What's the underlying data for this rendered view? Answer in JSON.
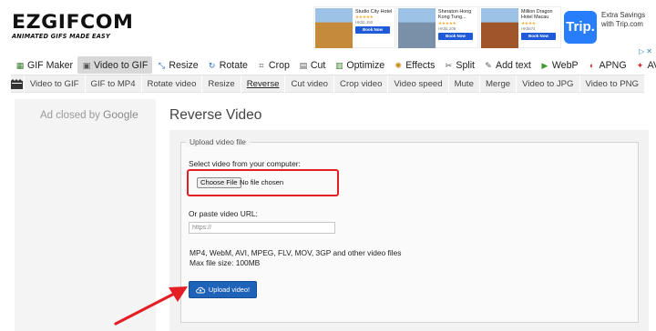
{
  "logo": {
    "main": "EZGIFCOM",
    "tagline": "ANIMATED GIFS MADE EASY"
  },
  "ad_banner": {
    "hotels": [
      {
        "name": "Studio City Hotel",
        "stars": "★★★★★",
        "price": "HK$1,150",
        "button": "Book Now",
        "image_color": "#c58a3a"
      },
      {
        "name": "Sheraton Hong Kong Tung...",
        "stars": "★★★★★",
        "price": "HK$1,208",
        "button": "Book Now",
        "image_color": "#7a8fa8"
      },
      {
        "name": "Million Dragon Hotel Macau",
        "stars": "★★★★",
        "price": "HK$474",
        "button": "Book Now",
        "image_color": "#a0552b"
      }
    ],
    "brand": "Trip.",
    "tagline": "Extra Savings with Trip.com",
    "close": "▷✕"
  },
  "toolbar": {
    "items": [
      {
        "label": "GIF Maker",
        "icon": "gif-maker-icon",
        "glyph": "▦",
        "color": "#3a7d2c",
        "active": false
      },
      {
        "label": "Video to GIF",
        "icon": "video-to-gif-icon",
        "glyph": "▣",
        "color": "#555",
        "active": true
      },
      {
        "label": "Resize",
        "icon": "resize-icon",
        "glyph": "⤡",
        "color": "#2a6fc9",
        "active": false
      },
      {
        "label": "Rotate",
        "icon": "rotate-icon",
        "glyph": "↻",
        "color": "#2a6fc9",
        "active": false
      },
      {
        "label": "Crop",
        "icon": "crop-icon",
        "glyph": "⌗",
        "color": "#555",
        "active": false
      },
      {
        "label": "Cut",
        "icon": "cut-icon",
        "glyph": "▤",
        "color": "#555",
        "active": false
      },
      {
        "label": "Optimize",
        "icon": "optimize-icon",
        "glyph": "▥",
        "color": "#3a7d2c",
        "active": false
      },
      {
        "label": "Effects",
        "icon": "effects-icon",
        "glyph": "✺",
        "color": "#c98a1a",
        "active": false
      },
      {
        "label": "Split",
        "icon": "split-icon",
        "glyph": "✂",
        "color": "#555",
        "active": false
      },
      {
        "label": "Add text",
        "icon": "add-text-icon",
        "glyph": "✎",
        "color": "#555",
        "active": false
      },
      {
        "label": "WebP",
        "icon": "webp-icon",
        "glyph": "▶",
        "color": "#3a9d2c",
        "active": false
      },
      {
        "label": "APNG",
        "icon": "apng-icon",
        "glyph": "◐",
        "color": "#d42a2a",
        "active": false
      },
      {
        "label": "AVIF",
        "icon": "avif-icon",
        "glyph": "✦",
        "color": "#d42a2a",
        "active": false
      }
    ]
  },
  "subbar": {
    "items": [
      {
        "label": "Video to GIF",
        "active": false
      },
      {
        "label": "GIF to MP4",
        "active": false
      },
      {
        "label": "Rotate video",
        "active": false
      },
      {
        "label": "Resize",
        "active": false
      },
      {
        "label": "Reverse",
        "active": true
      },
      {
        "label": "Cut video",
        "active": false
      },
      {
        "label": "Crop video",
        "active": false
      },
      {
        "label": "Video speed",
        "active": false
      },
      {
        "label": "Mute",
        "active": false
      },
      {
        "label": "Merge",
        "active": false
      },
      {
        "label": "Video to JPG",
        "active": false
      },
      {
        "label": "Video to PNG",
        "active": false
      }
    ]
  },
  "side_ad": {
    "prefix": "Ad closed by ",
    "brand": "Google"
  },
  "main": {
    "title": "Reverse Video",
    "legend": "Upload video file",
    "select_label": "Select video from your computer:",
    "choose_file": "Choose File",
    "file_status": "No file chosen",
    "url_label": "Or paste video URL:",
    "url_placeholder": "https://",
    "formats": "MP4, WebM, AVI, MPEG, FLV, MOV, 3GP and other video files",
    "max_size": "Max file size: 100MB",
    "upload_button": "Upload video!"
  },
  "colors": {
    "highlight": "#e31e24",
    "arrow": "#e31e24",
    "upload": "#1f63b8",
    "trip": "#287dfa"
  }
}
